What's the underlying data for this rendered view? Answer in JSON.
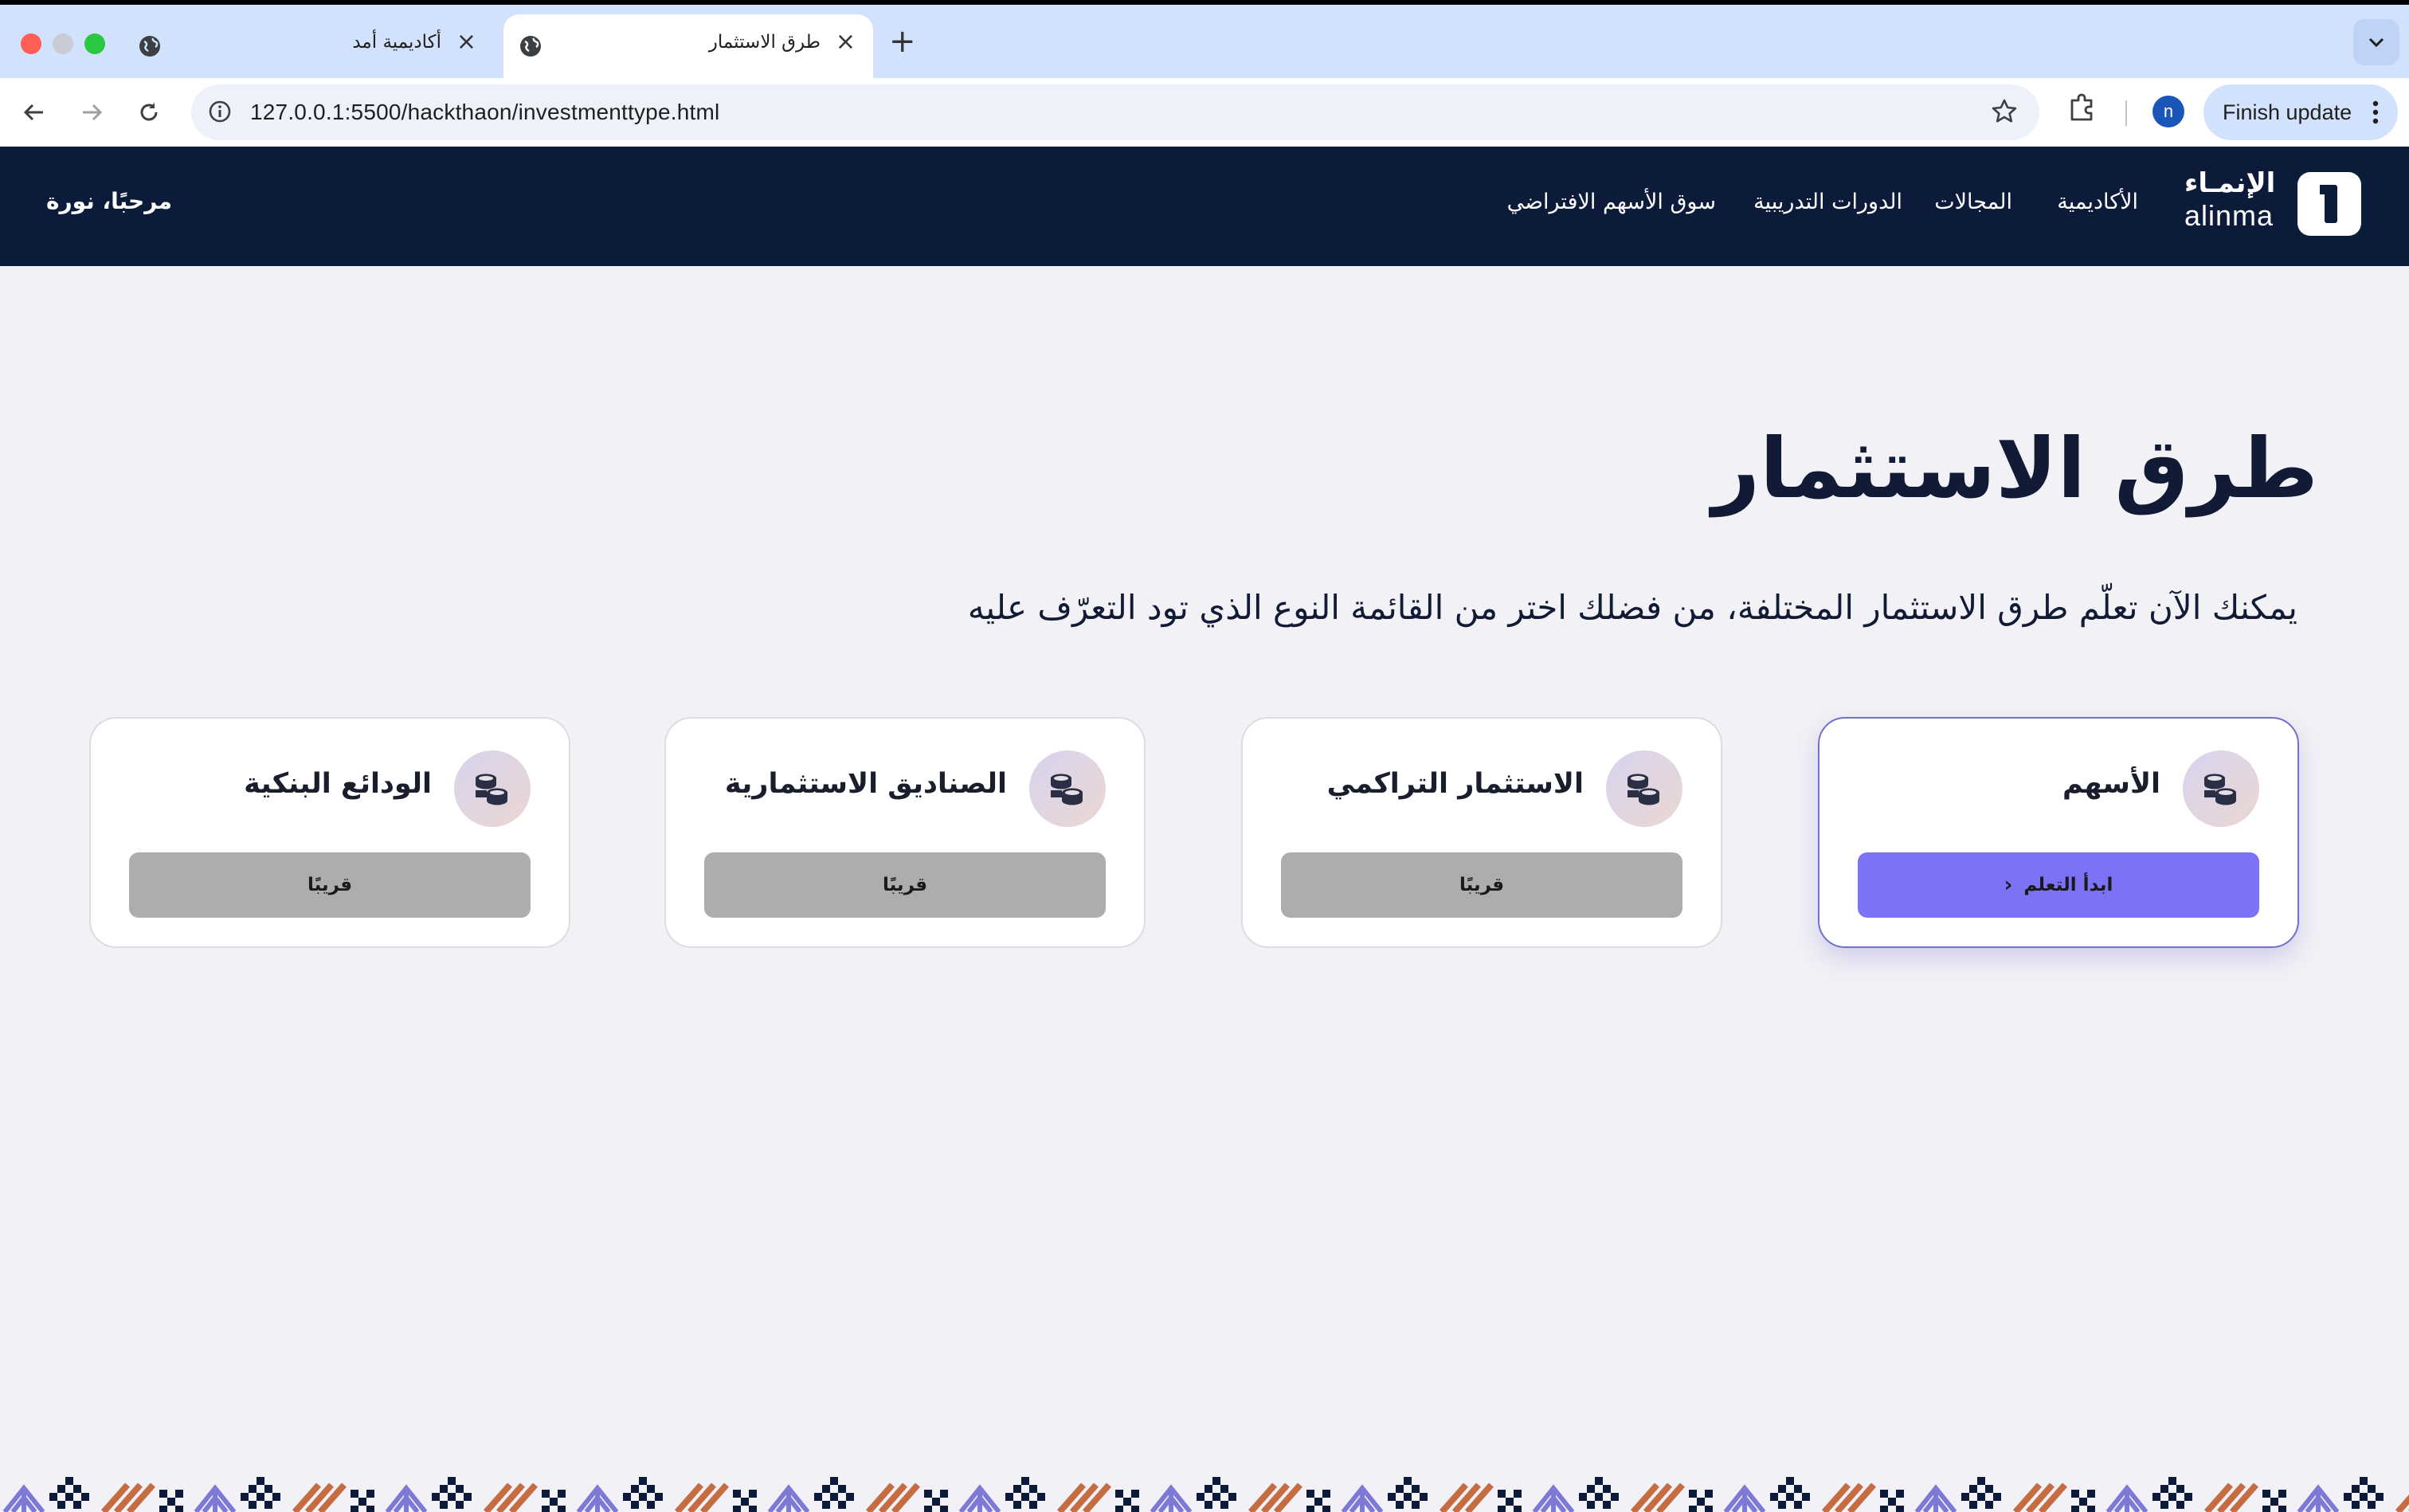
{
  "browser": {
    "tabs": [
      {
        "title": "أكاديمية أمد",
        "active": false
      },
      {
        "title": "طرق الاستثمار",
        "active": true
      }
    ],
    "url": "127.0.0.1:5500/hackthaon/investmenttype.html",
    "profile_initial": "n",
    "update_label": "Finish update"
  },
  "header": {
    "logo_ar": "الإنمـاء",
    "logo_en": "alinma",
    "nav": [
      "الأكاديمية",
      "المجالات",
      "الدورات التدريبية",
      "سوق الأسهم الافتراضي"
    ],
    "greeting": "مرحبًا، نورة"
  },
  "page": {
    "title": "طرق الاستثمار",
    "subtitle": "يمكنك الآن تعلّم طرق الاستثمار المختلفة، من فضلك اختر من القائمة النوع الذي تود التعرّف عليه"
  },
  "cards": [
    {
      "title": "الأسهم",
      "button": "ابدأ التعلم",
      "active": true,
      "icon": "coins-stack-icon"
    },
    {
      "title": "الاستثمار التراكمي",
      "button": "قريبًا",
      "active": false,
      "icon": "coins-stack-icon"
    },
    {
      "title": "الصناديق الاستثمارية",
      "button": "قريبًا",
      "active": false,
      "icon": "coins-stack-icon"
    },
    {
      "title": "الودائع البنكية",
      "button": "قريبًا",
      "active": false,
      "icon": "coins-stack-icon"
    }
  ],
  "colors": {
    "header_bg": "#0c1b3a",
    "page_bg": "#f2f1f6",
    "accent": "#7b72f6",
    "disabled": "#adadad"
  }
}
